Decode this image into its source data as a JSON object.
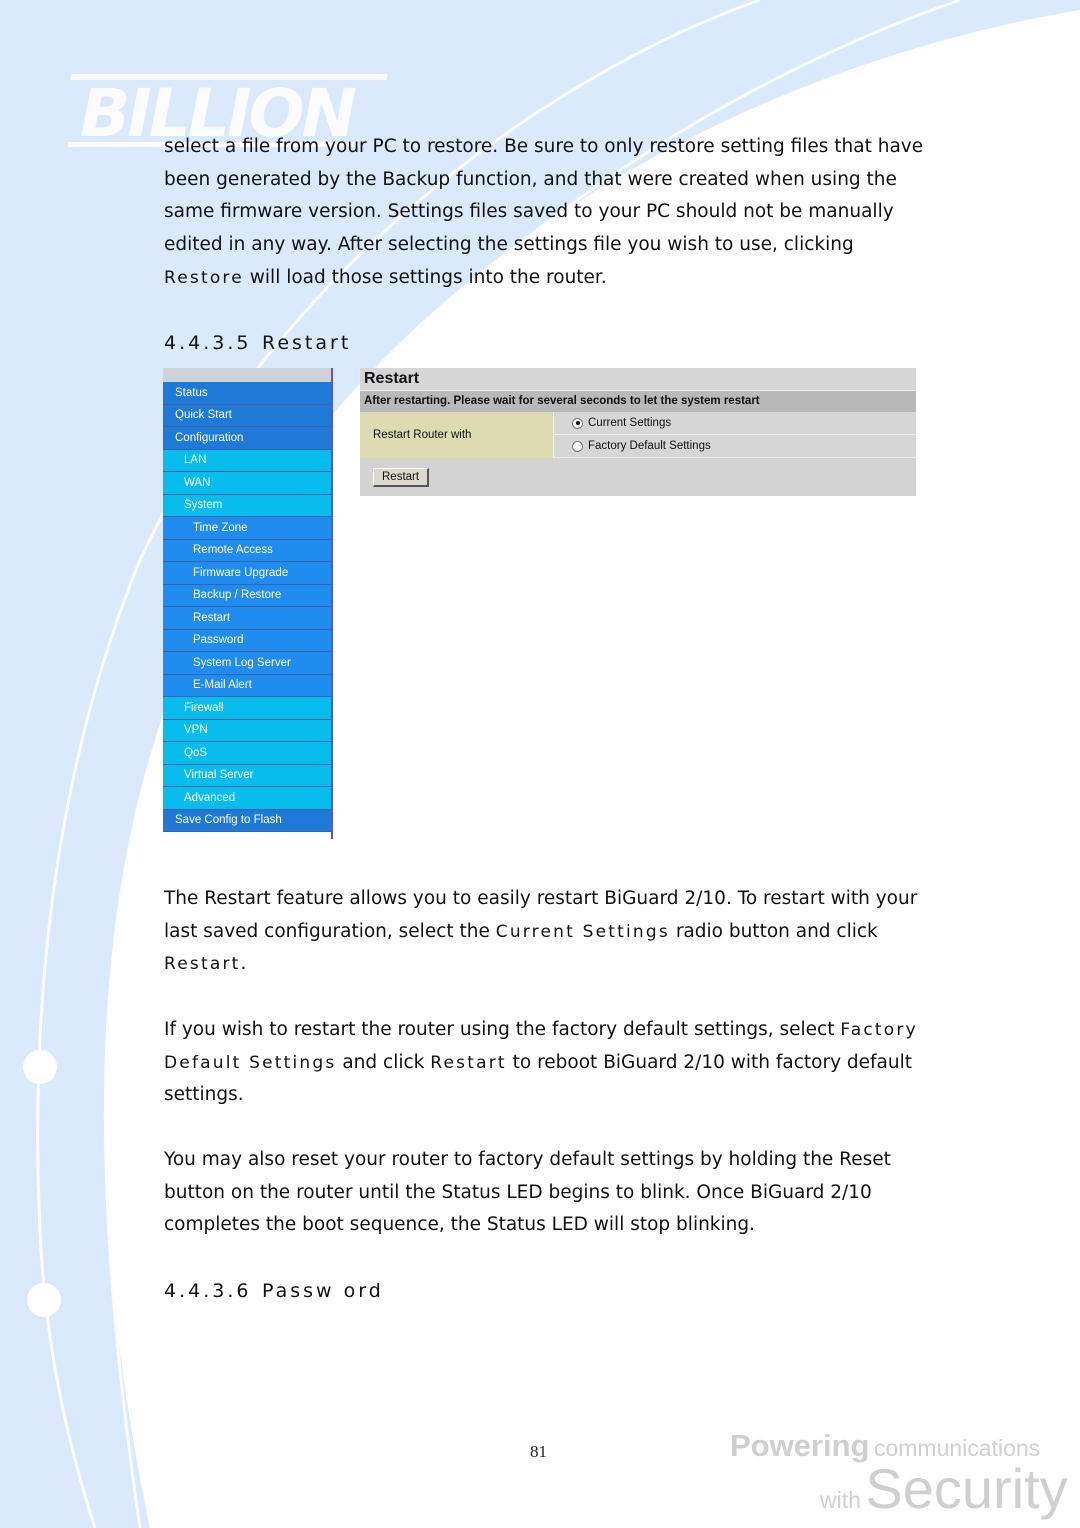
{
  "brand": {
    "logo_text": "BILLION",
    "tagline_line1_strong": "Powering",
    "tagline_line1_rest": "communications",
    "tagline_line2_small": "with",
    "tagline_line2_big": "Security"
  },
  "intro_paragraph": {
    "lead": "select a file from your PC to restore. Be sure to only restore setting files that have been generated by the Backup function, and that were created when using the same firmware version. Settings files saved to your PC should not be manually edited in any way. After selecting the settings file you wish to use, clicking ",
    "term": "Restore",
    "tail": " will load those settings into the router."
  },
  "section_restart": {
    "number": "4.4.3.5",
    "title": "Restart"
  },
  "router_ui": {
    "sidebar": [
      {
        "label": "Status",
        "level": 0
      },
      {
        "label": "Quick Start",
        "level": 0
      },
      {
        "label": "Configuration",
        "level": 0
      },
      {
        "label": "LAN",
        "level": 1
      },
      {
        "label": "WAN",
        "level": 1
      },
      {
        "label": "System",
        "level": 1
      },
      {
        "label": "Time Zone",
        "level": 2
      },
      {
        "label": "Remote Access",
        "level": 2
      },
      {
        "label": "Firmware Upgrade",
        "level": 2
      },
      {
        "label": "Backup / Restore",
        "level": 2
      },
      {
        "label": "Restart",
        "level": 2
      },
      {
        "label": "Password",
        "level": 2
      },
      {
        "label": "System Log Server",
        "level": 2
      },
      {
        "label": "E-Mail Alert",
        "level": 2
      },
      {
        "label": "Firewall",
        "level": 1
      },
      {
        "label": "VPN",
        "level": 1
      },
      {
        "label": "QoS",
        "level": 1
      },
      {
        "label": "Virtual Server",
        "level": 1
      },
      {
        "label": "Advanced",
        "level": 1
      },
      {
        "label": "Save Config to Flash",
        "level": 0
      }
    ],
    "panel": {
      "title": "Restart",
      "notice": "After restarting. Please wait for several seconds to let the system restart",
      "field_label": "Restart Router with",
      "options": [
        {
          "label": "Current Settings",
          "checked": true
        },
        {
          "label": "Factory Default Settings",
          "checked": false
        }
      ],
      "button_label": "Restart"
    }
  },
  "paragraph_1": {
    "a": "The Restart feature allows you to easily restart BiGuard 2/10. To restart with your last saved configuration, select the ",
    "term1": "Current Settings",
    "b": " radio button and click ",
    "term2": "Restart",
    "c": "."
  },
  "paragraph_2": {
    "a": "If you wish to restart the router using the factory default settings, select ",
    "term1": "Factory Default Settings",
    "b": " and click ",
    "term2": "Restart",
    "c": " to reboot BiGuard 2/10 with factory default settings."
  },
  "paragraph_3": "You may also reset your router to factory default settings by holding the Reset button on the router until the Status LED begins to blink. Once BiGuard 2/10 completes the boot sequence, the Status LED will stop blinking.",
  "section_password": {
    "number": "4.4.3.6",
    "title": "Passw ord"
  },
  "page_number": "81",
  "colors": {
    "background_blue": "#dae9fb",
    "nav_level0": "#1e7ad6",
    "nav_level1": "#06bdee",
    "nav_level2": "#1f8cf0",
    "panel_gray": "#d3d3d3",
    "panel_label_khaki": "#dcdbb2"
  }
}
